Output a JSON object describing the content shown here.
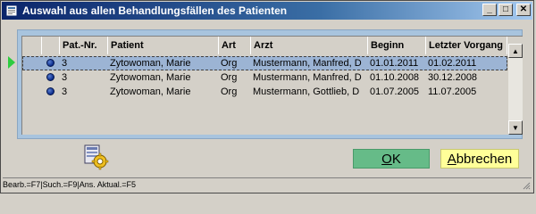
{
  "window": {
    "title": "Auswahl aus allen Behandlungsfällen des Patienten",
    "min": "_",
    "max": "□",
    "close": "✕"
  },
  "table": {
    "columns": [
      "Pat.-Nr.",
      "Patient",
      "Art",
      "Arzt",
      "Beginn",
      "Letzter Vorgang"
    ],
    "rows": [
      {
        "patnr": "3",
        "patient": "Zytowoman, Marie",
        "art": "Org",
        "arzt": "Mustermann, Manfred, D",
        "beginn": "01.01.2011",
        "letzter": "01.02.2011",
        "selected": true
      },
      {
        "patnr": "3",
        "patient": "Zytowoman, Marie",
        "art": "Org",
        "arzt": "Mustermann, Manfred, D",
        "beginn": "01.10.2008",
        "letzter": "30.12.2008",
        "selected": false
      },
      {
        "patnr": "3",
        "patient": "Zytowoman, Marie",
        "art": "Org",
        "arzt": "Mustermann, Gottlieb, D",
        "beginn": "01.07.2005",
        "letzter": "11.07.2005",
        "selected": false
      }
    ]
  },
  "buttons": {
    "ok_pre": "",
    "ok_u": "O",
    "ok_post": "K",
    "cancel_pre": "",
    "cancel_u": "A",
    "cancel_post": "bbrechen"
  },
  "statusbar": {
    "text": "Bearb.=F7|Such.=F9|Ans. Aktual.=F5"
  },
  "colors": {
    "title_start": "#0a246a",
    "panel": "#a8c4de",
    "selected_row": "#9cb4d4",
    "ok": "#66bb88",
    "cancel": "#ffff99"
  },
  "icons": [
    "window-app-icon",
    "row-marker-icon",
    "current-row-arrow-icon",
    "settings-gear-icon"
  ]
}
